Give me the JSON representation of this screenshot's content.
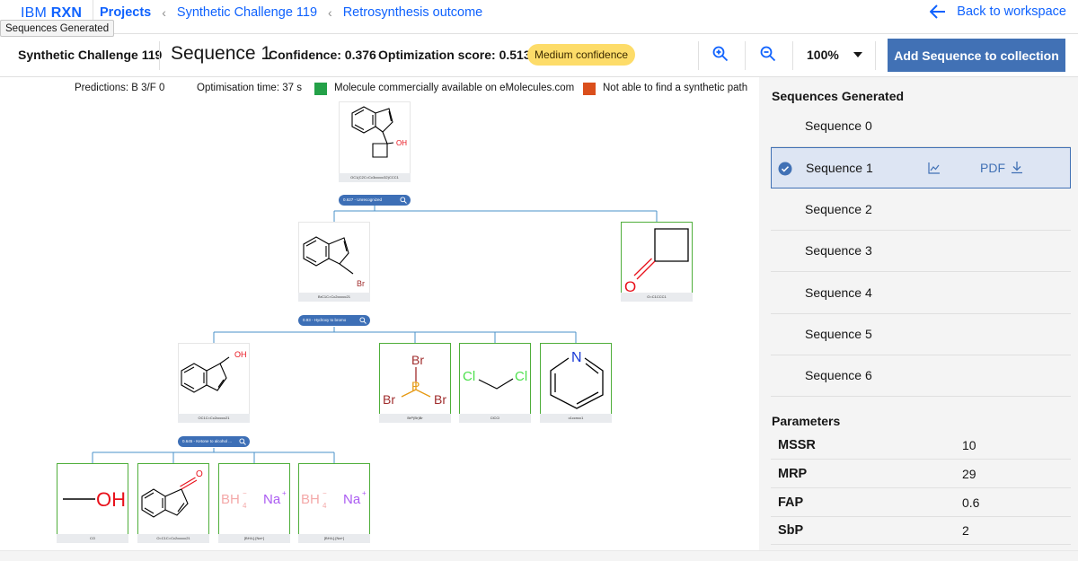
{
  "nav": {
    "brand_light": "IBM",
    "brand_bold": "RXN",
    "breadcrumbs": [
      "Projects",
      "Synthetic Challenge 119",
      "Retrosynthesis outcome"
    ],
    "back_label": "Back to workspace",
    "tooltip": "Sequences Generated"
  },
  "toolbar": {
    "project": "Synthetic Challenge 119",
    "sequence": "Sequence 1",
    "confidence": "Confidence: 0.376",
    "optimization": "Optimization score: 0.513",
    "badge": "Medium confidence",
    "zoom": "100%",
    "add_button": "Add Sequence to collection"
  },
  "legend": {
    "predictions": "Predictions: B 3/F 0",
    "optimisation_time": "Optimisation time: 37 s",
    "available": "Molecule commercially available on eMolecules.com",
    "not_able": "Not able to find a synthetic path",
    "available_color": "#24a148",
    "not_able_color": "#da4f1c"
  },
  "tree": {
    "molecules": {
      "target": "OC1(C2C=Cc3ccccc32)CCC1",
      "bromoindene": "BrC1C=Cc2ccccc21",
      "cyclobutanone": "O=C1CCC1",
      "indenol": "OC1C=Cc2ccccc21",
      "pbr3": "BrP(Br)Br",
      "dcm": "ClCCl",
      "pyridine": "c1ccncc1",
      "methanol": "CO",
      "indenone": "O=C1C=Cc2ccccc21",
      "nabh4_a": "[BH4-].[Na+]",
      "nabh4_b": "[BH4-].[Na+]"
    },
    "reactions": {
      "r1": "0.627 - Unrecognized",
      "r2": "0.93 - Hydroxy to bromo",
      "r3": "0.645 - Ketone to alcohol ..."
    },
    "atoms": {
      "oh": "OH",
      "br": "Br",
      "o": "O",
      "cl": "Cl",
      "n": "N",
      "p": "P",
      "bh4": "BH",
      "na": "Na"
    }
  },
  "panel": {
    "sequences_title": "Sequences Generated",
    "sequences": [
      "Sequence 0",
      "Sequence 1",
      "Sequence 2",
      "Sequence 3",
      "Sequence 4",
      "Sequence 5",
      "Sequence 6"
    ],
    "selected_index": 1,
    "pdf_label": "PDF",
    "parameters_title": "Parameters",
    "parameters": [
      {
        "key": "MSSR",
        "value": "10"
      },
      {
        "key": "MRP",
        "value": "29"
      },
      {
        "key": "FAP",
        "value": "0.6"
      },
      {
        "key": "SbP",
        "value": "2"
      }
    ]
  },
  "colors": {
    "accent": "#0f62fe",
    "button": "#4171b5",
    "badge": "#fddc69",
    "panel_bg": "#f4f4f4",
    "oxygen": "#e8111b",
    "bromine": "#a02d2d",
    "chlorine": "#4ce04c",
    "nitrogen": "#1a3bd6",
    "phosphorus": "#e69a14"
  }
}
